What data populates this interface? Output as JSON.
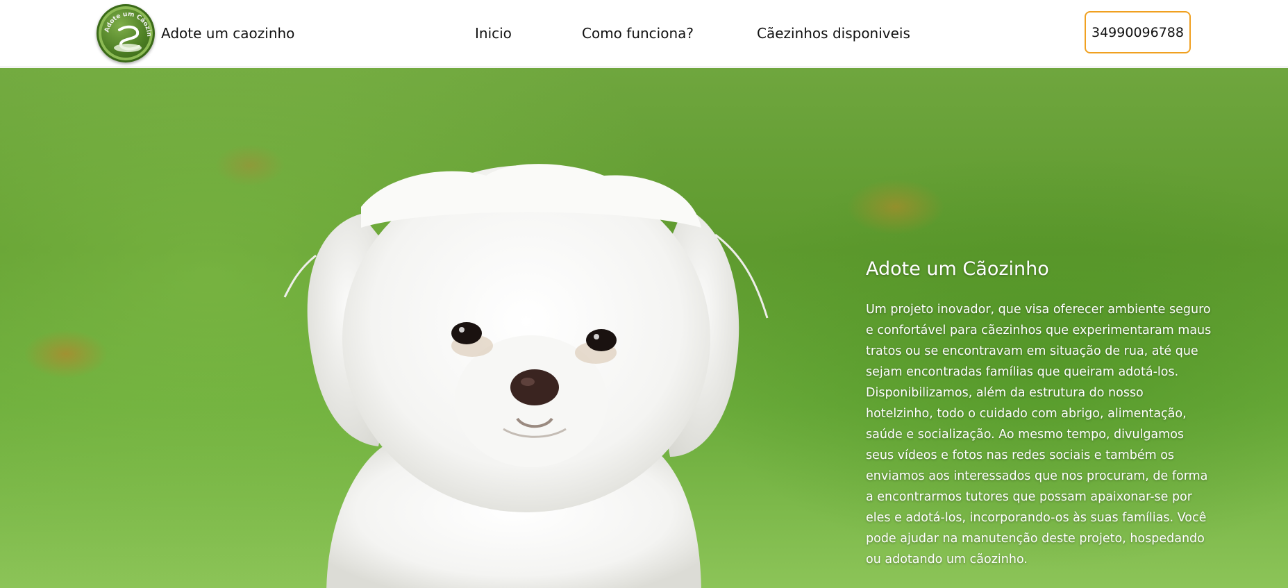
{
  "header": {
    "brand_name": "Adote um caozinho",
    "logo_text": "Adote um Cãozinho",
    "nav": [
      {
        "label": "Inicio"
      },
      {
        "label": "Como funciona?"
      },
      {
        "label": "Cãezinhos disponiveis"
      }
    ],
    "phone": "34990096788",
    "accent_color": "#f0a020"
  },
  "hero": {
    "title": "Adote um Cãozinho",
    "description": "Um projeto inovador, que visa oferecer ambiente seguro e confortável para cãezinhos que experimentaram maus tratos ou se encontravam em situação de rua, até que sejam encontradas famílias que queiram adotá-los. Disponibilizamos, além da estrutura do nosso hotelzinho, todo o cuidado com abrigo, alimentação, saúde e socialização. Ao mesmo tempo, divulgamos seus vídeos e fotos nas redes sociais e também os enviamos aos interessados que nos procuram, de forma a encontrarmos tutores que possam apaixonar-se por eles e adotá-los, incorporando-os às suas famílias. Você pode ajudar na manutenção deste projeto, hospedando ou adotando um cãozinho.",
    "image": "white-maltese-dog-on-grass"
  }
}
